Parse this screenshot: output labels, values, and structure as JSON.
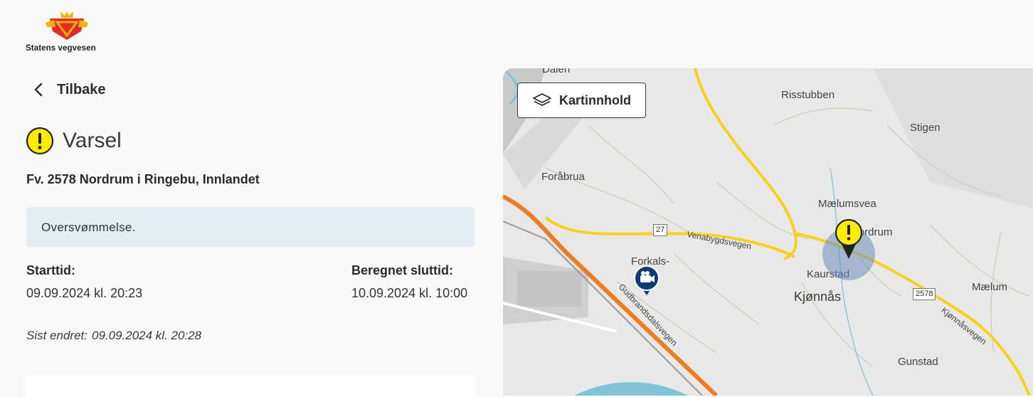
{
  "brand": {
    "name": "Statens vegvesen"
  },
  "nav": {
    "back_label": "Tilbake"
  },
  "notice": {
    "type_label": "Varsel",
    "location": "Fv. 2578 Nordrum i Ringebu, Innlandet",
    "description": "Oversvømmelse.",
    "start_label": "Starttid:",
    "start_value": "09.09.2024 kl. 20:23",
    "end_label": "Beregnet sluttid:",
    "end_value": "10.09.2024 kl. 10:00",
    "changed_label": "Sist endret:",
    "changed_value": "09.09.2024 kl. 20:28"
  },
  "map": {
    "layers_button": "Kartinnhold",
    "places": {
      "dalen": "Dalen",
      "risstubben": "Risstubben",
      "stigen": "Stigen",
      "forabrua": "Foråbrua",
      "maelumsvea": "Mælumsvea",
      "nordrum": "Nordrum",
      "forkals": "Forkals-",
      "kaurstad": "Kaurstad",
      "kjonnas": "Kjønnås",
      "maelum": "Mælum",
      "gunstad": "Gunstad"
    },
    "road_badges": {
      "r27": "27",
      "r2578": "2578"
    },
    "road_names": {
      "venabygdsvegen": "Venabygdsvegen",
      "gudbrandsdalsvegen": "Gudbrandsdalsvegen",
      "kjonnasvegen": "Kjønnåsvegen"
    },
    "icons": {
      "warning_marker": "warning-marker-icon",
      "camera_marker": "camera-marker-icon",
      "layers": "layers-icon"
    },
    "colors": {
      "warning": "#ffec00",
      "main_road": "#f7d21b",
      "european_road": "#f07c1b",
      "camera_marker": "#0b3b7a"
    }
  }
}
